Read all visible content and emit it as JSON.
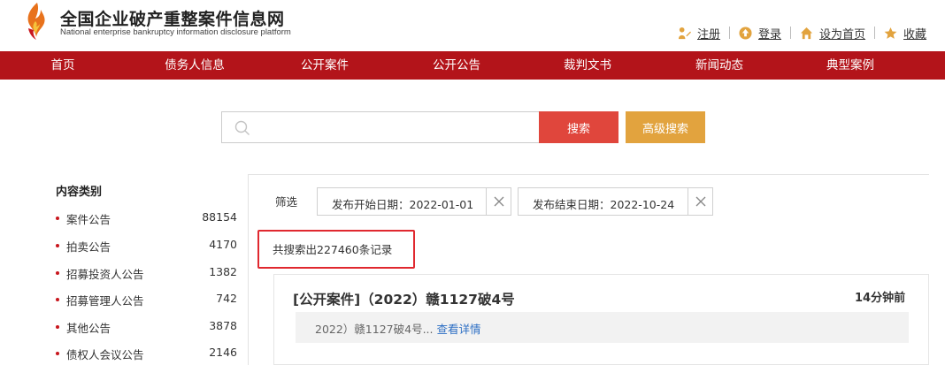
{
  "header": {
    "title": "全国企业破产重整案件信息网",
    "subtitle": "National enterprise bankruptcy information disclosure platform",
    "top_links": [
      {
        "label": "注册",
        "icon": "register-icon"
      },
      {
        "label": "登录",
        "icon": "login-icon"
      },
      {
        "label": "设为首页",
        "icon": "home-icon"
      },
      {
        "label": "收藏",
        "icon": "star-icon"
      }
    ]
  },
  "nav": {
    "items": [
      "首页",
      "债务人信息",
      "公开案件",
      "公开公告",
      "裁判文书",
      "新闻动态",
      "典型案例"
    ]
  },
  "search": {
    "value": "",
    "placeholder": "",
    "search_label": "搜索",
    "advanced_label": "高级搜索"
  },
  "sidebar": {
    "title": "内容类别",
    "items": [
      {
        "label": "案件公告",
        "count": "88154"
      },
      {
        "label": "拍卖公告",
        "count": "4170"
      },
      {
        "label": "招募投资人公告",
        "count": "1382"
      },
      {
        "label": "招募管理人公告",
        "count": "742"
      },
      {
        "label": "其他公告",
        "count": "3878"
      },
      {
        "label": "债权人会议公告",
        "count": "2146"
      }
    ]
  },
  "filters": {
    "label": "筛选",
    "tags": [
      "发布开始日期：2022-01-01",
      "发布结束日期：2022-10-24"
    ]
  },
  "results": {
    "count_text": "共搜索出227460条记录",
    "items": [
      {
        "title": "[公开案件]（2022）赣1127破4号",
        "time": "14分钟前",
        "summary": "2022）赣1127破4号...",
        "detail_label": "查看详情"
      }
    ]
  },
  "colors": {
    "nav_bg": "#b3141a",
    "search_button": "#e0463c",
    "advanced_button": "#e2a33e",
    "highlight_border": "#e0282f",
    "link": "#2d6fc4"
  }
}
